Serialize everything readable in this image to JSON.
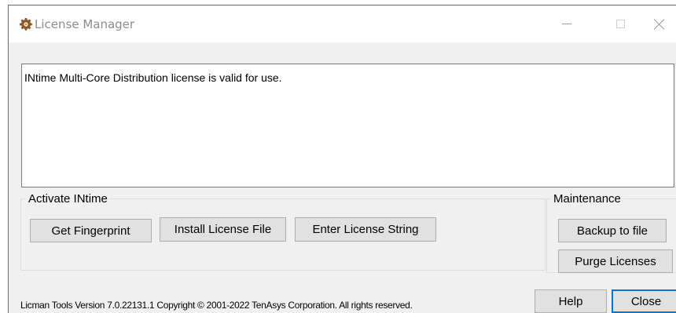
{
  "window": {
    "title": "License Manager",
    "icon": "gear-icon"
  },
  "titlebar_buttons": {
    "minimize_icon": "minimize-icon",
    "maximize_icon": "maximize-icon",
    "close_icon": "close-icon"
  },
  "status": {
    "message": "INtime Multi-Core Distribution license is valid for use."
  },
  "activate_group": {
    "label": "Activate INtime",
    "get_fingerprint": "Get Fingerprint",
    "install_license_file": "Install License File",
    "enter_license_string": "Enter License String"
  },
  "maintenance_group": {
    "label": "Maintenance",
    "backup_to_file": "Backup to file",
    "purge_licenses": "Purge Licenses"
  },
  "footer": {
    "version_text": "Licman Tools Version 7.0.22131.1 Copyright © 2001-2022 TenAsys Corporation. All rights reserved.",
    "help": "Help",
    "close": "Close"
  },
  "colors": {
    "window_bg": "#f0f0f0",
    "button_bg": "#e1e1e1",
    "default_button_border": "#0078d7"
  }
}
